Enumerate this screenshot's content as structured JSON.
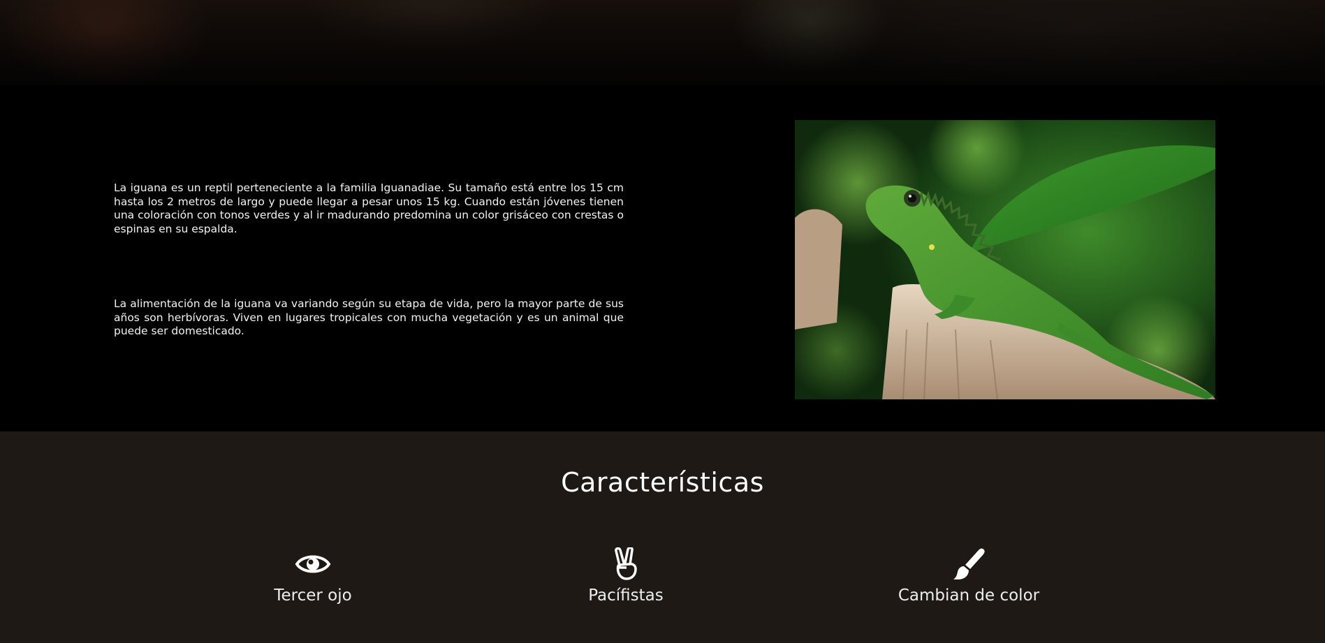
{
  "intro": {
    "paragraphs": [
      "La iguana es un reptil perteneciente a la familia Iguanadiae. Su tamaño está entre los 15 cm hasta los 2 metros de largo y puede llegar a pesar unos 15 kg. Cuando están jóvenes tienen una coloración con tonos verdes y al ir madurando predomina un color grisáceo con crestas o espinas en su espalda.",
      "La alimentación de la iguana va variando según su etapa de vida, pero la mayor parte de sus años son herbívoras. Viven en lugares tropicales con mucha vegetación y es un animal que puede ser domesticado."
    ]
  },
  "features": {
    "title": "Características",
    "items": [
      {
        "icon": "eye-icon",
        "label": "Tercer ojo"
      },
      {
        "icon": "peace-hand-icon",
        "label": "Pacífistas"
      },
      {
        "icon": "paint-brush-icon",
        "label": "Cambian de color"
      }
    ]
  },
  "colors": {
    "background": "#000000",
    "features_background": "#1e1914",
    "text": "#ffffff"
  }
}
